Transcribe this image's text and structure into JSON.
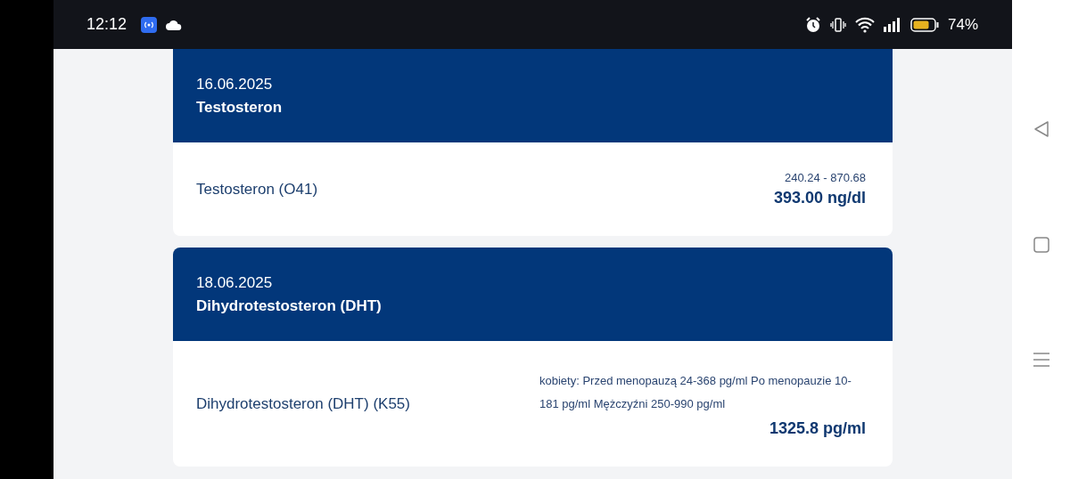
{
  "status_bar": {
    "time": "12:12",
    "battery": "74%"
  },
  "results": [
    {
      "date": "16.06.2025",
      "title": "Testosteron",
      "test": "Testosteron (O41)",
      "range": "240.24 - 870.68",
      "value": "393.00 ng/dl"
    },
    {
      "date": "18.06.2025",
      "title": "Dihydrotestosteron (DHT)",
      "test": "Dihydrotestosteron (DHT) (K55)",
      "range": "kobiety: Przed menopauzą 24-368 pg/ml Po menopauzie 10-181 pg/ml Mężczyźni 250-990 pg/ml",
      "value": "1325.8 pg/ml"
    }
  ]
}
